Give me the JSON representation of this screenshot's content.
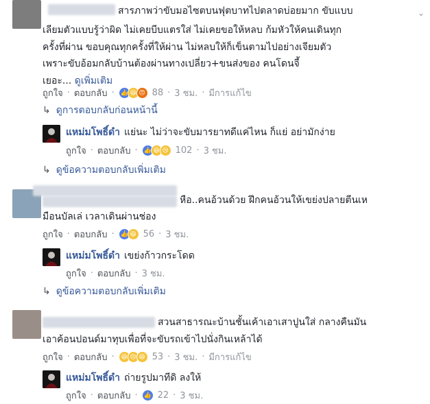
{
  "comments": [
    {
      "text_lines": [
        "สารภาพว่าขับมอไซตบนฟุตบาทไปตลาดบ่อยมาก ขับแบบ",
        "เลียมตัวแบบรู้ว่าผิด ไม่เคยบีบแตรใส่ ไม่เคยขอให้หลบ ก้มหัวให้คนเดินทุก",
        "ครั้งที่ผ่าน ขอบคุณทุกครั้งที่ให้ผ่าน ไม่หลบให้ก็เข็นตามไปอย่างเจียมตัว",
        "เพราะขับอ้อมกลับบ้านต้องผ่านทางเปลี่ยว+ขนส่งของ คนโดนจี้"
      ],
      "last_line": "เยอะ...",
      "see_more": "ดูเพิ่มเติม",
      "like": "ถูกใจ",
      "reply": "ตอบกลับ",
      "reaction_count": "88",
      "time": "3 ชม.",
      "edited": "มีการแก้ไข",
      "prev_replies": "ดูการตอบกลับก่อนหน้านี้",
      "reply_item": {
        "name": "แหม่มโพธิ์ดำ",
        "text": "แย่นะ ไม่ว่าจะขับมารยาทดีแค่ไหน ก็แย่ อย่ามักง่าย",
        "like": "ถูกใจ",
        "reply": "ตอบกลับ",
        "reaction_count": "102",
        "time": "3 ชม."
      },
      "more_replies": "ดูข้อความตอบกลับเพิ่มเติม"
    },
    {
      "text_line1": "หือ..คนอ้วนด้วย ฝึกคนอ้วนให้เขย่งปลายตีนเห",
      "text_line2": "มือนบัลเล่ เวลาเดินผ่านช่อง",
      "like": "ถูกใจ",
      "reply": "ตอบกลับ",
      "reaction_count": "56",
      "time": "3 ชม.",
      "reply_item": {
        "name": "แหม่มโพธิ์ดำ",
        "text": "เขย่งก้าวกระโดด",
        "like": "ถูกใจ",
        "reply": "ตอบกลับ",
        "time": "3 ชม."
      },
      "more_replies": "ดูข้อความตอบกลับเพิ่มเติม"
    },
    {
      "text_line1": "สวนสาธารณะบ้านชั้นเค้าเอาเสาปูนใส่ กลางคืนมัน",
      "text_line2": "เอาค้อนปอนด์มาทุบเพื่อที่จะขับรถเข้าไปนั่งกินเหล้าได้",
      "like": "ถูกใจ",
      "reply": "ตอบกลับ",
      "reaction_count": "53",
      "time": "3 ชม.",
      "edited": "มีการแก้ไข",
      "reply_item": {
        "name": "แหม่มโพธิ์ดำ",
        "text": "ถ่ายรูปมาทีดิ ลงให้",
        "like": "ถูกใจ",
        "reply": "ตอบกลับ",
        "reaction_count": "22",
        "time": "3 ชม."
      }
    }
  ]
}
